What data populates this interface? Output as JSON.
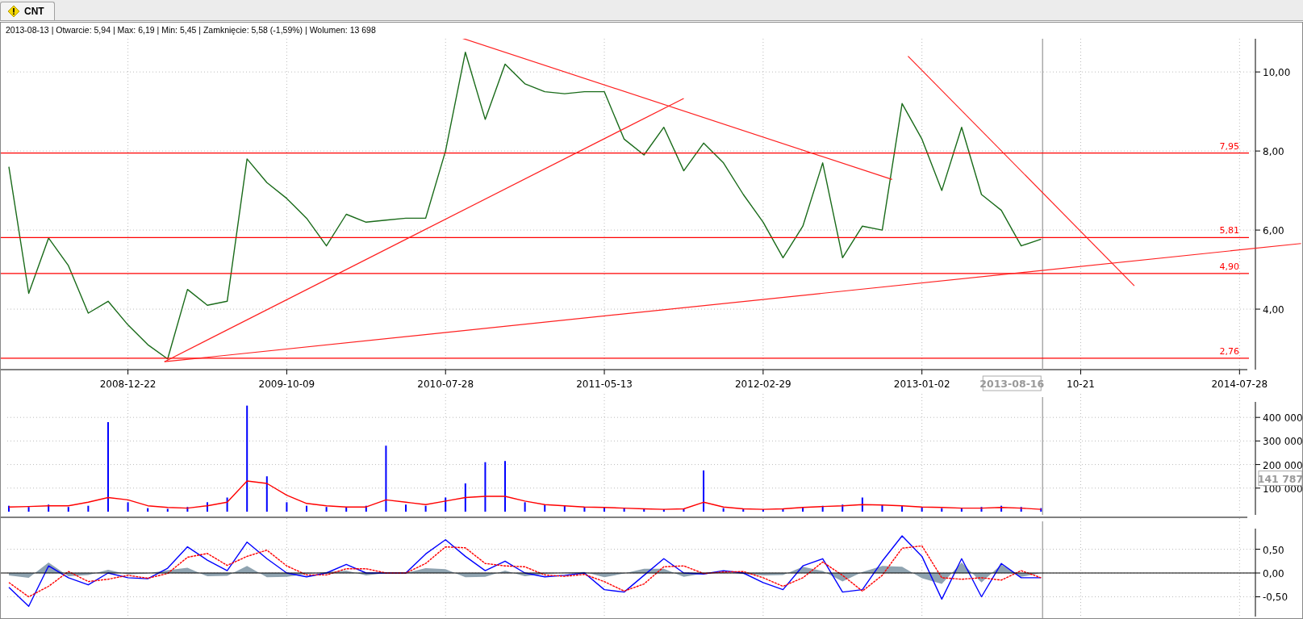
{
  "tabs": [
    {
      "label": "CNT",
      "selected": true
    }
  ],
  "info": "2013-08-13 | Otwarcie: 5,94 | Max: 6,19 | Min: 5,45 | Zamknięcie: 5,58 (-1,59%)  | Wolumen: 13 698",
  "price_panel": {
    "chart_data": {
      "type": "line",
      "grid": true,
      "ylim": [
        2.47,
        10.84
      ],
      "categories": [
        null,
        null,
        null,
        null,
        null,
        null,
        "2008-12-22",
        null,
        null,
        null,
        null,
        null,
        null,
        null,
        "2009-10-09",
        null,
        null,
        null,
        null,
        null,
        null,
        null,
        "2010-07-28",
        null,
        null,
        null,
        null,
        null,
        null,
        null,
        "2011-05-13",
        null,
        null,
        null,
        null,
        null,
        null,
        null,
        "2012-02-29",
        null,
        null,
        null,
        null,
        null,
        null,
        null,
        "2013-01-02",
        null,
        null,
        null,
        null,
        null,
        null,
        null,
        "10-21",
        null,
        null,
        null,
        null,
        null,
        null,
        null,
        "2014-07-28"
      ],
      "yticks": [
        {
          "value": 4,
          "label": "4,00"
        },
        {
          "value": 6,
          "label": "6,00"
        },
        {
          "value": 8,
          "label": "8,00"
        },
        {
          "value": 10,
          "label": "10,00"
        }
      ],
      "series": [
        {
          "color": "#1a6b1a",
          "values": [
            7.6,
            4.4,
            5.8,
            5.1,
            3.9,
            4.2,
            3.6,
            3.1,
            2.74,
            4.5,
            4.1,
            4.2,
            7.8,
            7.2,
            6.8,
            6.3,
            5.6,
            6.4,
            6.2,
            6.25,
            6.3,
            6.3,
            8.0,
            10.5,
            8.8,
            10.2,
            9.7,
            9.5,
            9.45,
            9.5,
            9.5,
            8.3,
            7.9,
            8.6,
            7.5,
            8.2,
            7.7,
            6.9,
            6.2,
            5.3,
            6.1,
            7.7,
            5.3,
            6.1,
            6.0,
            9.2,
            8.3,
            7.0,
            8.6,
            6.9,
            6.5,
            5.6,
            5.77,
            null,
            null,
            null,
            null,
            null,
            null,
            null,
            null,
            null,
            null
          ]
        }
      ],
      "ref_lines": [
        {
          "axis": "y",
          "value": 7.95,
          "label": "7,95"
        },
        {
          "axis": "y",
          "value": 5.81,
          "label": "5,81"
        },
        {
          "axis": "y",
          "value": 4.9,
          "label": "4,90"
        },
        {
          "axis": "y",
          "value": 2.76,
          "label": "2,76"
        }
      ]
    },
    "cursor_label": "2013-08-16"
  },
  "volume_panel": {
    "chart_data": {
      "type": "bar",
      "grid": true,
      "ylim": [
        0,
        500000
      ],
      "categories": [
        null,
        null,
        null,
        null,
        null,
        null,
        null,
        null,
        null,
        null,
        null,
        null,
        null,
        null,
        null,
        null,
        null,
        null,
        null,
        null,
        null,
        null,
        null,
        null,
        null,
        null,
        null,
        null,
        null,
        null,
        null,
        null,
        null,
        null,
        null,
        null,
        null,
        null,
        null,
        null,
        null,
        null,
        null,
        null,
        null,
        null,
        null,
        null,
        null,
        null,
        null,
        null,
        null,
        null,
        null,
        null,
        null,
        null,
        null,
        null,
        null,
        null,
        null
      ],
      "yticks": [
        {
          "value": 100000,
          "label": "100 000"
        },
        {
          "value": 200000,
          "label": "200 000"
        },
        {
          "value": 300000,
          "label": "300 000"
        },
        {
          "value": 400000,
          "label": "400 000"
        }
      ],
      "series": [
        {
          "color": "#0000ff",
          "values": [
            25000,
            20000,
            30000,
            20000,
            25000,
            380000,
            40000,
            15000,
            12000,
            20000,
            40000,
            60000,
            450000,
            150000,
            40000,
            25000,
            20000,
            18000,
            25000,
            280000,
            30000,
            25000,
            60000,
            120000,
            210000,
            215000,
            40000,
            30000,
            25000,
            20000,
            20000,
            15000,
            12000,
            10000,
            12000,
            175000,
            15000,
            10000,
            10000,
            12000,
            20000,
            25000,
            30000,
            60000,
            30000,
            25000,
            20000,
            15000,
            15000,
            20000,
            25000,
            20000,
            15000,
            null,
            null,
            null,
            null,
            null,
            null,
            null,
            null,
            null,
            null
          ]
        },
        {
          "type": "line",
          "color": "#ff0000",
          "values": [
            20000,
            22000,
            25000,
            25000,
            40000,
            60000,
            50000,
            25000,
            18000,
            15000,
            25000,
            40000,
            130000,
            120000,
            70000,
            35000,
            25000,
            20000,
            20000,
            50000,
            40000,
            30000,
            45000,
            60000,
            65000,
            65000,
            45000,
            30000,
            25000,
            20000,
            18000,
            15000,
            12000,
            10000,
            12000,
            40000,
            20000,
            12000,
            10000,
            12000,
            18000,
            22000,
            25000,
            30000,
            28000,
            25000,
            20000,
            18000,
            15000,
            15000,
            18000,
            15000,
            10000,
            null,
            null,
            null,
            null,
            null,
            null,
            null,
            null,
            null,
            null
          ]
        }
      ]
    },
    "cursor_label": "141 787"
  },
  "macd_panel": {
    "chart_data": {
      "type": "line",
      "grid": true,
      "ylim": [
        -0.95,
        0.95
      ],
      "categories": [
        null,
        null,
        null,
        null,
        null,
        null,
        null,
        null,
        null,
        null,
        null,
        null,
        null,
        null,
        null,
        null,
        null,
        null,
        null,
        null,
        null,
        null,
        null,
        null,
        null,
        null,
        null,
        null,
        null,
        null,
        null,
        null,
        null,
        null,
        null,
        null,
        null,
        null,
        null,
        null,
        null,
        null,
        null,
        null,
        null,
        null,
        null,
        null,
        null,
        null,
        null,
        null,
        null,
        null,
        null,
        null,
        null,
        null,
        null,
        null,
        null,
        null,
        null
      ],
      "yticks": [
        {
          "value": -0.5,
          "label": "-0,50"
        },
        {
          "value": 0,
          "label": "0,00"
        },
        {
          "value": 0.5,
          "label": "0,50"
        }
      ],
      "series": [
        {
          "type": "area",
          "color": "#8fa3b0",
          "values": [
            -0.05,
            -0.1,
            0.22,
            -0.07,
            -0.04,
            0.07,
            -0.03,
            -0.01,
            0.06,
            0.11,
            -0.07,
            -0.06,
            0.15,
            -0.09,
            -0.08,
            -0.02,
            0.02,
            0.05,
            -0.05,
            0,
            0,
            0.1,
            0.08,
            -0.09,
            -0.08,
            0.05,
            -0.07,
            -0.02,
            0.01,
            0.02,
            -0.09,
            -0.01,
            0.09,
            0.09,
            -0.08,
            -0.01,
            0.02,
            -0.02,
            -0.05,
            -0.04,
            0.13,
            0.04,
            -0.18,
            0.02,
            0.15,
            0.13,
            -0.11,
            -0.23,
            0.22,
            -0.2,
            0.18,
            -0.08,
            0,
            null,
            null,
            null,
            null,
            null,
            null,
            null,
            null,
            null,
            null
          ]
        },
        {
          "color": "#0000ff",
          "values": [
            -0.3,
            -0.7,
            0.15,
            -0.1,
            -0.25,
            0.0,
            -0.1,
            -0.12,
            0.1,
            0.55,
            0.27,
            0.05,
            0.65,
            0.3,
            0.0,
            -0.08,
            0.0,
            0.18,
            0.0,
            0.0,
            0.0,
            0.4,
            0.7,
            0.35,
            0.05,
            0.25,
            0.0,
            -0.08,
            -0.05,
            0.0,
            -0.35,
            -0.4,
            -0.05,
            0.3,
            0.0,
            -0.02,
            0.05,
            0.0,
            -0.2,
            -0.35,
            0.15,
            0.3,
            -0.4,
            -0.35,
            0.25,
            0.78,
            0.35,
            -0.55,
            0.3,
            -0.5,
            0.2,
            -0.1,
            -0.1,
            null,
            null,
            null,
            null,
            null,
            null,
            null,
            null,
            null,
            null
          ]
        },
        {
          "line_style": "dashed",
          "color": "#ff0000",
          "values": [
            -0.2,
            -0.5,
            -0.28,
            0.03,
            -0.18,
            -0.13,
            -0.05,
            -0.11,
            -0.01,
            0.33,
            0.41,
            0.16,
            0.35,
            0.48,
            0.15,
            -0.04,
            -0.04,
            0.09,
            0.09,
            0.0,
            0.0,
            0.2,
            0.55,
            0.53,
            0.2,
            0.15,
            0.13,
            -0.04,
            -0.07,
            -0.03,
            -0.18,
            -0.38,
            -0.23,
            0.13,
            0.15,
            -0.01,
            0.02,
            0.03,
            -0.1,
            -0.28,
            -0.1,
            0.23,
            -0.05,
            -0.38,
            -0.05,
            0.52,
            0.57,
            -0.1,
            -0.13,
            -0.1,
            -0.15,
            0.05,
            -0.1,
            null,
            null,
            null,
            null,
            null,
            null,
            null,
            null,
            null,
            null
          ]
        }
      ]
    }
  }
}
